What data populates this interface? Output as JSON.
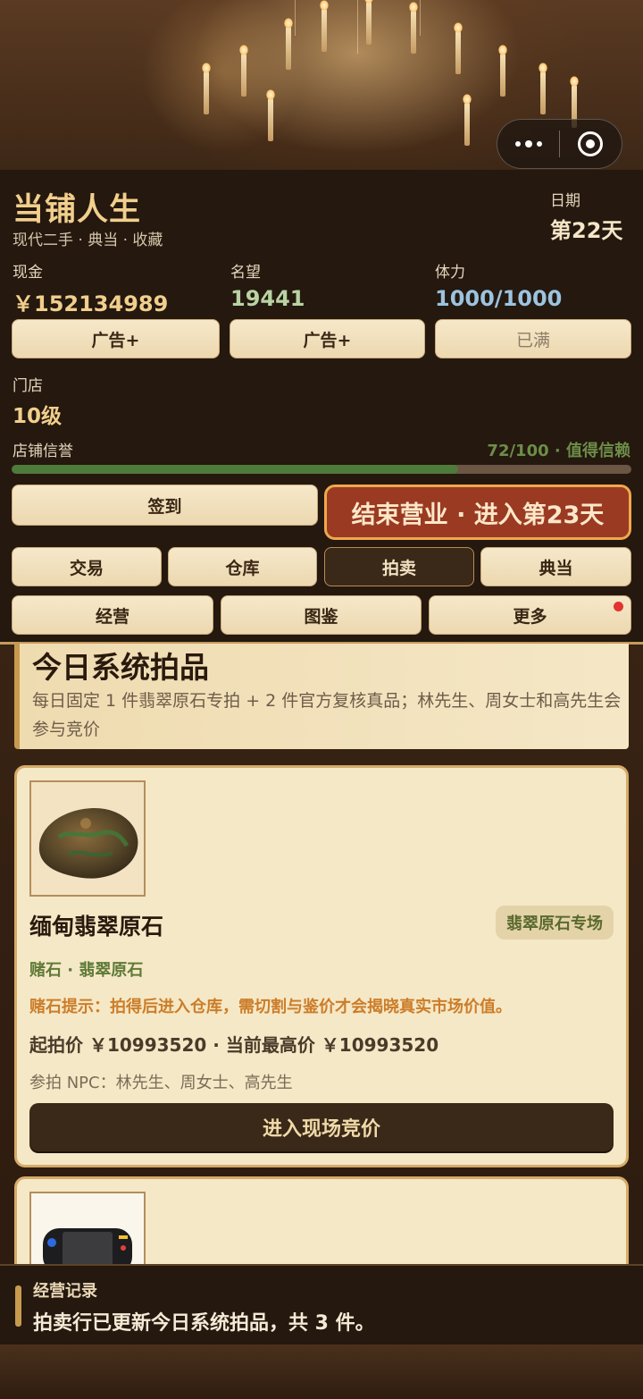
{
  "app": {
    "title": "当铺人生",
    "subtitle": "现代二手 · 典当 · 收藏"
  },
  "date": {
    "label": "日期",
    "value": "第22天"
  },
  "stats": {
    "cash": {
      "label": "现金",
      "value": "￥152134989",
      "color": "#f1cf8c"
    },
    "fame": {
      "label": "名望",
      "value": "19441",
      "color": "#b9d3a2"
    },
    "stamina": {
      "label": "体力",
      "value": "1000/1000",
      "color": "#9cc3df"
    }
  },
  "stat_buttons": {
    "cash_ad": "广告+",
    "fame_ad": "广告+",
    "stamina_full": "已满"
  },
  "shop": {
    "label": "门店",
    "value": "10级"
  },
  "reputation": {
    "label": "店铺信誉",
    "value_text": "72/100 · 值得信赖",
    "progress": 0.72
  },
  "actions": {
    "checkin": "签到",
    "end_day": "结束营业 · 进入第23天"
  },
  "tabs_row1": [
    "交易",
    "仓库",
    "拍卖",
    "典当"
  ],
  "tabs_row2": [
    "经营",
    "图鉴",
    "更多"
  ],
  "active_tab": "拍卖",
  "banner": {
    "title": "今日系统拍品",
    "description": "每日固定 1 件翡翠原石专拍 + 2 件官方复核真品；林先生、周女士和高先生会参与竞价"
  },
  "items": [
    {
      "name": "缅甸翡翠原石",
      "tag": "翡翠原石专场",
      "category": "赌石 · 翡翠原石",
      "hint": "赌石提示：拍得后进入仓库，需切割与鉴价才会揭晓真实市场价值。",
      "price": "起拍价 ￥10993520 · 当前最高价 ￥10993520",
      "npc": "参拍 NPC：林先生、周女士、高先生",
      "button": "进入现场竞价",
      "icon": "jade-stone-icon"
    },
    {
      "icon": "game-console-icon"
    }
  ],
  "log": {
    "label": "经营记录",
    "text": "拍卖行已更新今日系统拍品，共 3 件。"
  }
}
